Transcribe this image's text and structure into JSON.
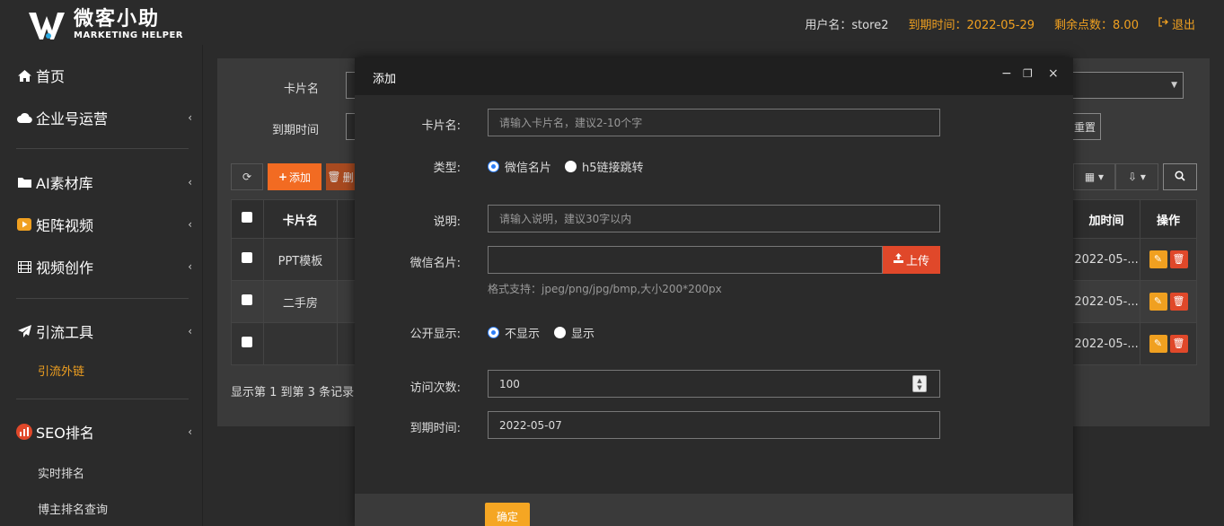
{
  "header": {
    "logo_cn": "微客小助",
    "logo_en": "MARKETING HELPER",
    "username": "用户名：store2",
    "expire": "到期时间：2022-05-29",
    "points": "剩余点数：8.00",
    "logout": "退出"
  },
  "sidebar": {
    "items": [
      {
        "label": "首页",
        "icon": "home-icon"
      },
      {
        "label": "企业号运营",
        "icon": "cloud-icon"
      },
      {
        "label": "AI素材库",
        "icon": "folder-icon"
      },
      {
        "label": "矩阵视频",
        "icon": "video-play-icon"
      },
      {
        "label": "视频创作",
        "icon": "film-icon"
      },
      {
        "label": "引流工具",
        "icon": "send-icon"
      },
      {
        "label": "SEO排名",
        "icon": "seo-icon"
      }
    ],
    "sub_traffic": "引流外链",
    "sub_seo_1": "实时排名",
    "sub_seo_2": "博主排名查询"
  },
  "background": {
    "filter_card_name": "卡片名",
    "filter_expire": "到期时间",
    "reset_button": "重置",
    "add_button": "添加",
    "delete_button": "删",
    "table": {
      "headers": [
        "卡片名",
        "加时间",
        "操作"
      ],
      "rows": [
        {
          "name": "PPT模板",
          "time": "2022-05-..."
        },
        {
          "name": "二手房",
          "time": "2022-05-..."
        },
        {
          "name": "",
          "time": "2022-05-..."
        }
      ]
    },
    "pager": "显示第 1 到第 3 条记录，"
  },
  "modal": {
    "title": "添加",
    "card_name_label": "卡片名:",
    "card_name_placeholder": "请输入卡片名，建议2-10个字",
    "type_label": "类型:",
    "type_option_1": "微信名片",
    "type_option_2": "h5链接跳转",
    "desc_label": "说明:",
    "desc_placeholder": "请输入说明，建议30字以内",
    "wechat_card_label": "微信名片:",
    "upload_button": "上传",
    "format_hint": "格式支持：jpeg/png/jpg/bmp,大小200*200px",
    "public_label": "公开显示:",
    "public_option_1": "不显示",
    "public_option_2": "显示",
    "visits_label": "访问次数:",
    "visits_value": "100",
    "expire_label": "到期时间:",
    "expire_value": "2022-05-07",
    "ok_button": "确定"
  },
  "colors": {
    "accent_orange": "#f0a020",
    "danger_red": "#e0482a",
    "radio_blue": "#2d7ff9"
  }
}
